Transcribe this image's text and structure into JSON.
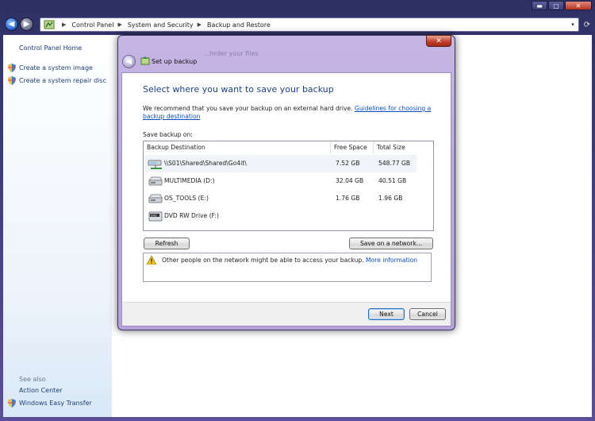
{
  "window": {
    "controls": {
      "minimize": "▬",
      "maximize": "▢",
      "close": "✕"
    }
  },
  "address": {
    "crumbs": [
      "Control Panel",
      "System and Security",
      "Backup and Restore"
    ],
    "dropdown": "▾"
  },
  "sidebar": {
    "home": "Control Panel Home",
    "items": [
      {
        "label": "Create a system image",
        "icon": "shield-icon"
      },
      {
        "label": "Create a system repair disc",
        "icon": "shield-icon"
      }
    ],
    "see_also": "See also",
    "see_also_items": [
      {
        "label": "Action Center"
      },
      {
        "label": "Windows Easy Transfer",
        "icon": "shield-icon"
      }
    ]
  },
  "dialog": {
    "title": "Set up backup",
    "ghost_text": "...hrder your files",
    "heading": "Select where you want to save your backup",
    "recommend_text": "We recommend that you save your backup on an external hard drive.",
    "guidelines_link": "Guidelines for choosing a backup destination",
    "save_label": "Save backup on:",
    "columns": [
      "Backup Destination",
      "Free Space",
      "Total Size"
    ],
    "destinations": [
      {
        "name": "\\\\S01\\Shared\\Shared\\Go4it\\",
        "free": "7.52 GB",
        "total": "548.77 GB",
        "icon": "network-drive-icon",
        "selected": true
      },
      {
        "name": "MULTIMEDIA (D:)",
        "free": "32.04 GB",
        "total": "40.51 GB",
        "icon": "hard-drive-icon"
      },
      {
        "name": "OS_TOOLS (E:)",
        "free": "1.76 GB",
        "total": "1.96 GB",
        "icon": "hard-drive-icon"
      },
      {
        "name": "DVD RW Drive (F:)",
        "free": "",
        "total": "",
        "icon": "dvd-drive-icon"
      }
    ],
    "refresh_label": "Refresh",
    "save_network_label": "Save on a network...",
    "warning_text": "Other people on the network might be able to access your backup.",
    "more_info_link": "More information",
    "next_label": "Next",
    "cancel_label": "Cancel",
    "close_label": "✕"
  },
  "colors": {
    "link": "#0a4ebf",
    "heading": "#1b3f86",
    "sidebar_link": "#1d3e72",
    "frame": "#bba9dd"
  }
}
